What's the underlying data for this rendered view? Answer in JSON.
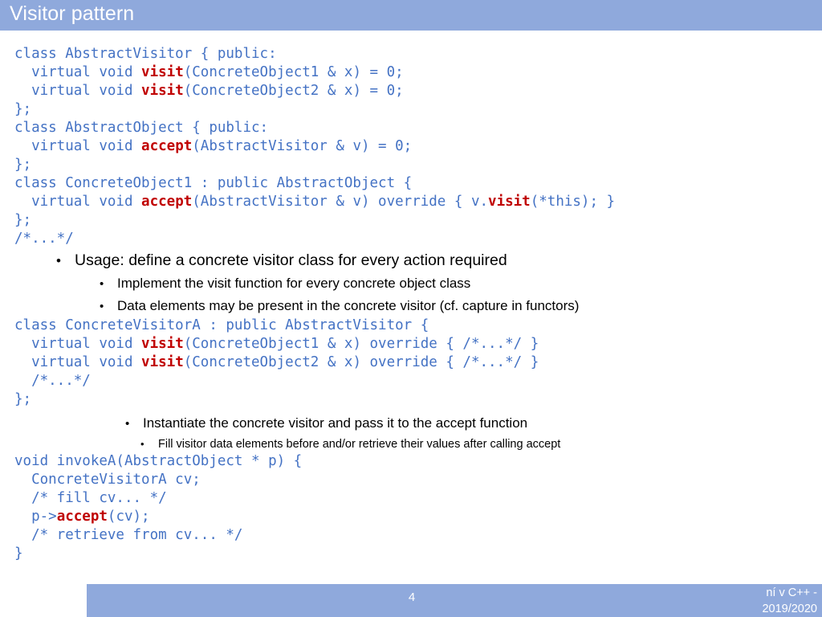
{
  "slide": {
    "title": "Visitor pattern",
    "title_bar_color": "#8FA9DC",
    "background_color": "#FFFFFF",
    "code_color": "#4472C4",
    "code_highlight_color": "#C00000",
    "text_color": "#000000"
  },
  "code_block_1": {
    "lines": [
      [
        {
          "t": "class AbstractVisitor { public:",
          "c": "blue"
        }
      ],
      [
        {
          "t": "  virtual void ",
          "c": "blue"
        },
        {
          "t": "visit",
          "c": "red"
        },
        {
          "t": "(ConcreteObject1 & x) = 0;",
          "c": "blue"
        }
      ],
      [
        {
          "t": "  virtual void ",
          "c": "blue"
        },
        {
          "t": "visit",
          "c": "red"
        },
        {
          "t": "(ConcreteObject2 & x) = 0;",
          "c": "blue"
        }
      ],
      [
        {
          "t": "};",
          "c": "blue"
        }
      ],
      [
        {
          "t": "class AbstractObject { public:",
          "c": "blue"
        }
      ],
      [
        {
          "t": "  virtual void ",
          "c": "blue"
        },
        {
          "t": "accept",
          "c": "red"
        },
        {
          "t": "(AbstractVisitor & v) = 0;",
          "c": "blue"
        }
      ],
      [
        {
          "t": "};",
          "c": "blue"
        }
      ],
      [
        {
          "t": "class ConcreteObject1 : public AbstractObject {",
          "c": "blue"
        }
      ],
      [
        {
          "t": "  virtual void ",
          "c": "blue"
        },
        {
          "t": "accept",
          "c": "red"
        },
        {
          "t": "(AbstractVisitor & v) override { v.",
          "c": "blue"
        },
        {
          "t": "visit",
          "c": "red"
        },
        {
          "t": "(*this); }",
          "c": "blue"
        }
      ],
      [
        {
          "t": "};",
          "c": "blue"
        }
      ],
      [
        {
          "t": "/*...*/",
          "c": "blue"
        }
      ]
    ]
  },
  "bullets_1": [
    {
      "level": 1,
      "marker": "•",
      "text": "Usage: define a concrete visitor class for every action required"
    },
    {
      "level": 2,
      "marker": "•",
      "text": "Implement the visit function for every concrete object class"
    },
    {
      "level": 2,
      "marker": "•",
      "text": "Data elements may be present in the concrete visitor (cf. capture in functors)"
    }
  ],
  "code_block_2": {
    "lines": [
      [
        {
          "t": "class ConcreteVisitorA : public AbstractVisitor {",
          "c": "blue"
        }
      ],
      [
        {
          "t": "  virtual void ",
          "c": "blue"
        },
        {
          "t": "visit",
          "c": "red"
        },
        {
          "t": "(ConcreteObject1 & x) override { /*...*/ }",
          "c": "blue"
        }
      ],
      [
        {
          "t": "  virtual void ",
          "c": "blue"
        },
        {
          "t": "visit",
          "c": "red"
        },
        {
          "t": "(ConcreteObject2 & x) override { /*...*/ }",
          "c": "blue"
        }
      ],
      [
        {
          "t": "  /*...*/",
          "c": "blue"
        }
      ],
      [
        {
          "t": "};",
          "c": "blue"
        }
      ]
    ]
  },
  "bullets_2": [
    {
      "level": 2,
      "marker": "•",
      "text": "Instantiate the concrete visitor and pass it to the accept function"
    },
    {
      "level": 3,
      "marker": "•",
      "text": "Fill visitor data elements before and/or retrieve their values after calling accept"
    }
  ],
  "code_block_3": {
    "lines": [
      [
        {
          "t": "void invokeA(AbstractObject * p) {",
          "c": "blue"
        }
      ],
      [
        {
          "t": "  ConcreteVisitorA cv;",
          "c": "blue"
        }
      ],
      [
        {
          "t": "  /* fill cv... */",
          "c": "blue"
        }
      ],
      [
        {
          "t": "  p->",
          "c": "blue"
        },
        {
          "t": "accept",
          "c": "red"
        },
        {
          "t": "(cv);",
          "c": "blue"
        }
      ],
      [
        {
          "t": "  /* retrieve from cv... */",
          "c": "blue"
        }
      ],
      [
        {
          "t": "}",
          "c": "blue"
        }
      ]
    ]
  },
  "footer": {
    "page_number": "4",
    "credit_line_1": "ní v C++ -",
    "credit_line_2": "2019/2020",
    "bar_color": "#8FA9DC"
  }
}
